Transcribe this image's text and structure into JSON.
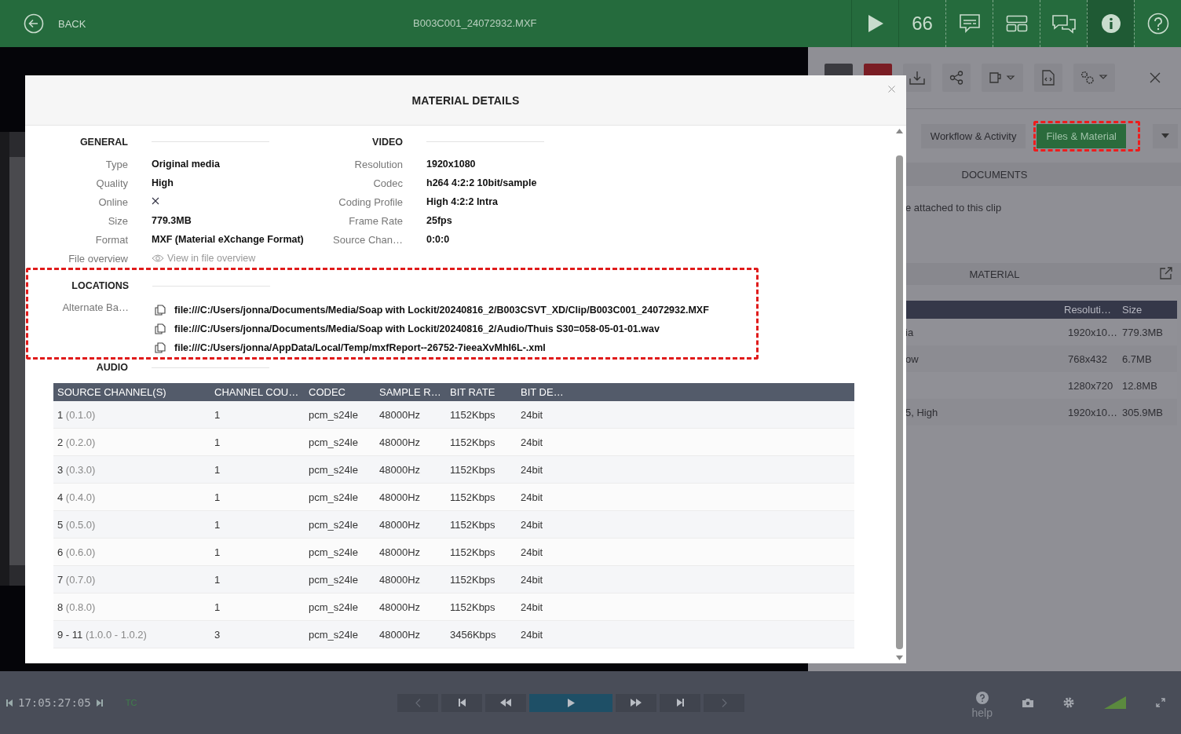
{
  "top_bar": {
    "back_label": "BACK",
    "title": "B003C001_24072932.MXF",
    "buttons": [
      {
        "kind": "play",
        "selected": false
      },
      {
        "kind": "count",
        "label": "66",
        "selected": false
      },
      {
        "kind": "subtitles",
        "selected": false
      },
      {
        "kind": "layout",
        "selected": false
      },
      {
        "kind": "chat",
        "selected": false
      },
      {
        "kind": "info",
        "selected": true
      },
      {
        "kind": "help",
        "selected": false
      }
    ]
  },
  "side_panel": {
    "tabs": [
      {
        "label": "Workflow & Activity",
        "selected": false
      },
      {
        "label": "Files & Material",
        "selected": true
      }
    ],
    "documents": {
      "title": "DOCUMENTS",
      "message": "e attached to this clip"
    },
    "material": {
      "title": "MATERIAL",
      "columns": [
        "Resoluti…",
        "Size"
      ],
      "rows": [
        {
          "name": "ia",
          "resolution": "1920x10…",
          "size": "779.3MB"
        },
        {
          "name": "ow",
          "resolution": "768x432",
          "size": "6.7MB"
        },
        {
          "resolution": "1280x720",
          "size": "12.8MB"
        },
        {
          "name": "5, High",
          "resolution": "1920x10…",
          "size": "305.9MB"
        }
      ]
    }
  },
  "modal": {
    "title": "MATERIAL DETAILS",
    "general": {
      "heading": "GENERAL",
      "fields": [
        {
          "kind": "text",
          "label": "Type",
          "value": "Original media"
        },
        {
          "kind": "text",
          "label": "Quality",
          "value": "High"
        },
        {
          "kind": "cross",
          "label": "Online"
        },
        {
          "kind": "text",
          "label": "Size",
          "value": "779.3MB"
        },
        {
          "kind": "text",
          "label": "Format",
          "value": "MXF (Material eXchange Format)"
        },
        {
          "kind": "link",
          "label": "File overview",
          "value": "View in file overview"
        }
      ]
    },
    "video": {
      "heading": "VIDEO",
      "fields": [
        {
          "kind": "text",
          "label": "Resolution",
          "value": "1920x1080"
        },
        {
          "kind": "text",
          "label": "Codec",
          "value": "h264 4:2:2 10bit/sample"
        },
        {
          "kind": "text",
          "label": "Coding Profile",
          "value": "High 4:2:2 Intra"
        },
        {
          "kind": "text",
          "label": "Frame Rate",
          "value": "25fps"
        },
        {
          "kind": "text",
          "label": "Source Chan…",
          "value": "0:0:0"
        }
      ]
    },
    "locations": {
      "heading": "LOCATIONS",
      "label": "Alternate Ba…",
      "paths": [
        "file:///C:/Users/jonna/Documents/Media/Soap with Lockit/20240816_2/B003CSVT_XD/Clip/B003C001_24072932.MXF",
        "file:///C:/Users/jonna/Documents/Media/Soap with Lockit/20240816_2/Audio/Thuis S30=058-05-01-01.wav",
        "file:///C:/Users/jonna/AppData/Local/Temp/mxfReport--26752-7ieeaXvMhI6L-.xml"
      ]
    },
    "audio": {
      "heading": "AUDIO",
      "columns": [
        "SOURCE CHANNEL(S)",
        "CHANNEL COU…",
        "CODEC",
        "SAMPLE R…",
        "BIT RATE",
        "BIT DE…"
      ],
      "rows": [
        {
          "channel": "1",
          "source": "(0.1.0)",
          "count": "1",
          "codec": "pcm_s24le",
          "sample_rate": "48000Hz",
          "bit_rate": "1152Kbps",
          "bit_depth": "24bit"
        },
        {
          "channel": "2",
          "source": "(0.2.0)",
          "count": "1",
          "codec": "pcm_s24le",
          "sample_rate": "48000Hz",
          "bit_rate": "1152Kbps",
          "bit_depth": "24bit"
        },
        {
          "channel": "3",
          "source": "(0.3.0)",
          "count": "1",
          "codec": "pcm_s24le",
          "sample_rate": "48000Hz",
          "bit_rate": "1152Kbps",
          "bit_depth": "24bit"
        },
        {
          "channel": "4",
          "source": "(0.4.0)",
          "count": "1",
          "codec": "pcm_s24le",
          "sample_rate": "48000Hz",
          "bit_rate": "1152Kbps",
          "bit_depth": "24bit"
        },
        {
          "channel": "5",
          "source": "(0.5.0)",
          "count": "1",
          "codec": "pcm_s24le",
          "sample_rate": "48000Hz",
          "bit_rate": "1152Kbps",
          "bit_depth": "24bit"
        },
        {
          "channel": "6",
          "source": "(0.6.0)",
          "count": "1",
          "codec": "pcm_s24le",
          "sample_rate": "48000Hz",
          "bit_rate": "1152Kbps",
          "bit_depth": "24bit"
        },
        {
          "channel": "7",
          "source": "(0.7.0)",
          "count": "1",
          "codec": "pcm_s24le",
          "sample_rate": "48000Hz",
          "bit_rate": "1152Kbps",
          "bit_depth": "24bit"
        },
        {
          "channel": "8",
          "source": "(0.8.0)",
          "count": "1",
          "codec": "pcm_s24le",
          "sample_rate": "48000Hz",
          "bit_rate": "1152Kbps",
          "bit_depth": "24bit"
        },
        {
          "channel": "9 - 11",
          "source": "(1.0.0 - 1.0.2)",
          "count": "3",
          "codec": "pcm_s24le",
          "sample_rate": "48000Hz",
          "bit_rate": "3456Kbps",
          "bit_depth": "24bit"
        }
      ]
    }
  },
  "player": {
    "timecode": "17:05:27:05",
    "tc_label": "TC",
    "controls": [
      {
        "kind": "prev",
        "disabled": true
      },
      {
        "kind": "skip_start",
        "disabled": false
      },
      {
        "kind": "rewind",
        "disabled": false
      },
      {
        "kind": "play",
        "disabled": false
      },
      {
        "kind": "fast_forward",
        "disabled": false
      },
      {
        "kind": "skip_end",
        "disabled": false
      },
      {
        "kind": "next",
        "disabled": true
      }
    ],
    "help_label": "help"
  }
}
